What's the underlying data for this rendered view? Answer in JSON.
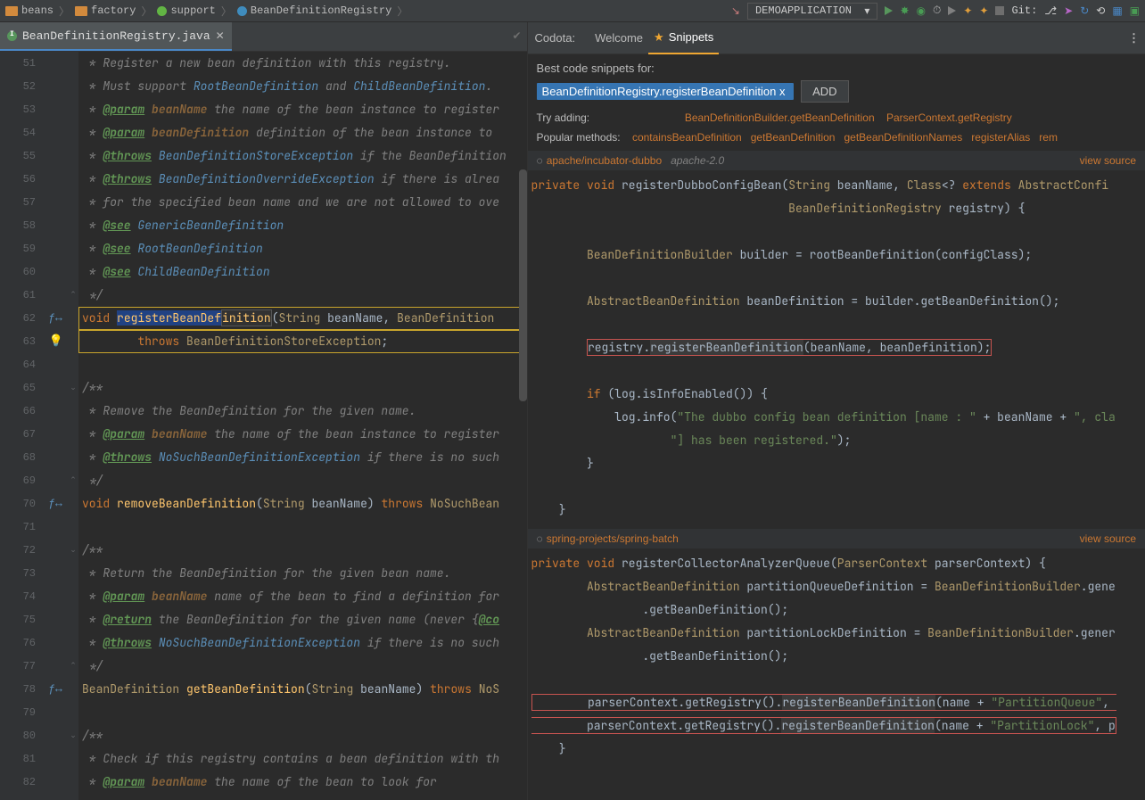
{
  "breadcrumbs": [
    "beans",
    "factory",
    "support",
    "BeanDefinitionRegistry"
  ],
  "run_config": "DEMOAPPLICATION",
  "git_label": "Git:",
  "editor_tab": "BeanDefinitionRegistry.java",
  "line_start": 51,
  "code_lines": [
    " * Register a new bean definition with this registry.",
    " * Must support RootBeanDefinition and ChildBeanDefinition.",
    " * @param beanName the name of the bean instance to register",
    " * @param beanDefinition definition of the bean instance to ",
    " * @throws BeanDefinitionStoreException if the BeanDefinition",
    " * @throws BeanDefinitionOverrideException if there is alrea",
    " * for the specified bean name and we are not allowed to ove",
    " * @see GenericBeanDefinition",
    " * @see RootBeanDefinition",
    " * @see ChildBeanDefinition",
    " */",
    "void registerBeanDefinition(String beanName, BeanDefinition",
    "        throws BeanDefinitionStoreException;",
    "",
    "/**",
    " * Remove the BeanDefinition for the given name.",
    " * @param beanName the name of the bean instance to register",
    " * @throws NoSuchBeanDefinitionException if there is no such",
    " */",
    "void removeBeanDefinition(String beanName) throws NoSuchBean",
    "",
    "/**",
    " * Return the BeanDefinition for the given bean name.",
    " * @param beanName name of the bean to find a definition for",
    " * @return the BeanDefinition for the given name (never {@co",
    " * @throws NoSuchBeanDefinitionException if there is no such",
    " */",
    "BeanDefinition getBeanDefinition(String beanName) throws NoS",
    "",
    "/**",
    " * Check if this registry contains a bean definition with th",
    " * @param beanName the name of the bean to look for"
  ],
  "codota": {
    "label": "Codota:",
    "tab_welcome": "Welcome",
    "tab_snippets": "Snippets",
    "best_for": "Best code snippets for:",
    "chip": "BeanDefinitionRegistry.registerBeanDefinition",
    "add": "ADD",
    "try_adding": "Try adding:",
    "sugg": [
      "BeanDefinitionBuilder.getBeanDefinition",
      "ParserContext.getRegistry"
    ],
    "pop_label": "Popular methods:",
    "pop": [
      "containsBeanDefinition",
      "getBeanDefinition",
      "getBeanDefinitionNames",
      "registerAlias",
      "rem"
    ],
    "snip1": {
      "repo": "apache/incubator-dubbo",
      "license": "apache-2.0",
      "view": "view source"
    },
    "snip2": {
      "repo": "spring-projects/spring-batch",
      "view": "view source"
    }
  }
}
